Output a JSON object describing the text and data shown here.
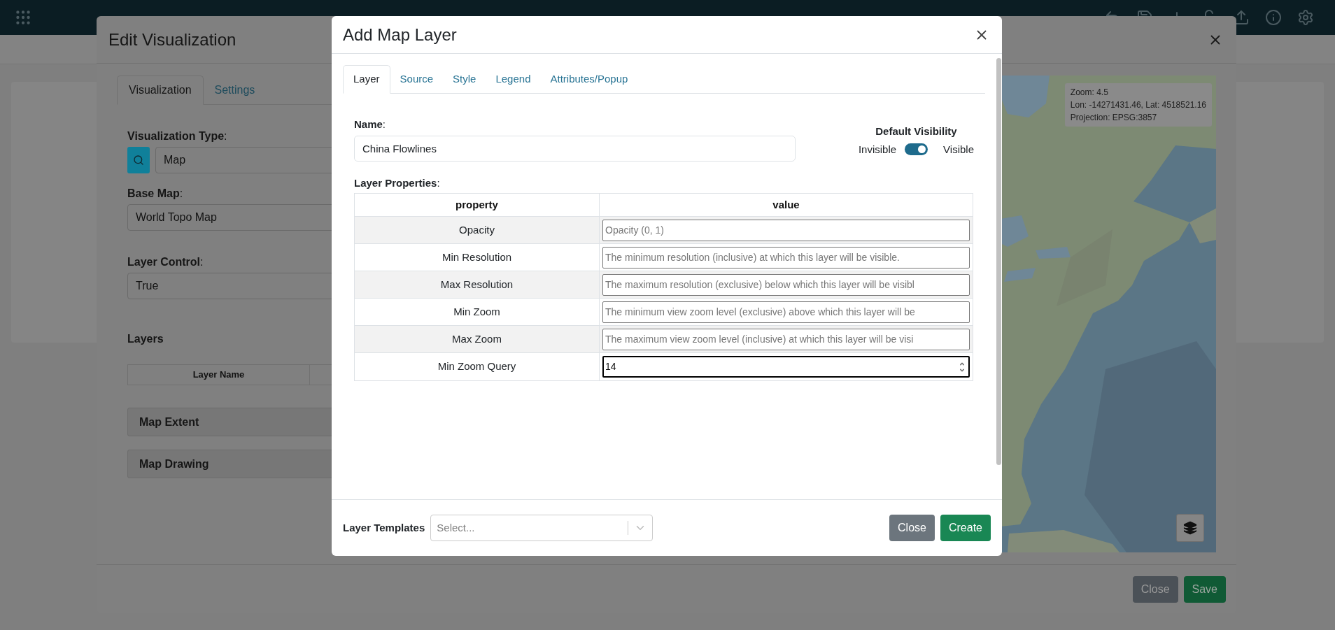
{
  "edit_dialog": {
    "title": "Edit Visualization",
    "tabs": [
      {
        "label": "Visualization",
        "selected": true
      },
      {
        "label": "Settings",
        "selected": false
      }
    ],
    "fields": [
      {
        "label": "**Visualization Type**:",
        "value": "Map",
        "kind": "search-select"
      },
      {
        "label": "**Base Map**:",
        "value": "World Topo Map",
        "kind": "select"
      },
      {
        "label": "**Layer Control**:",
        "value": "True",
        "kind": "select"
      }
    ],
    "layers": {
      "title": "Layers",
      "columns": [
        "Layer Name"
      ]
    },
    "sections": [
      "Map Extent",
      "Map Drawing"
    ],
    "map": {
      "kind": "picture",
      "info": [
        "Zoom: 4.5",
        "Lon: -14271431.46, Lat: 4518521.16",
        "Projection: EPSG:3857"
      ]
    },
    "buttons": [
      {
        "label": "Close",
        "kind": "secondary"
      },
      {
        "label": "Save",
        "kind": "primary"
      }
    ]
  },
  "layer_dialog": {
    "title": "Add Map Layer",
    "tabs": [
      {
        "label": "Layer",
        "selected": true
      },
      {
        "label": "Source",
        "selected": false
      },
      {
        "label": "Style",
        "selected": false
      },
      {
        "label": "Legend",
        "selected": false
      },
      {
        "label": "Attributes/Popup",
        "selected": false
      }
    ],
    "name": {
      "label": "**Name**:",
      "value": "China Flowlines"
    },
    "visibility": {
      "title": "Default Visibility",
      "off_label": "Invisible",
      "on_label": "Visible",
      "on": true
    },
    "properties": {
      "label": "**Layer Properties**:",
      "columns": [
        "property",
        "value"
      ],
      "rows": [
        {
          "property": "Opacity",
          "placeholder": "Opacity (0, 1)",
          "focused": false
        },
        {
          "property": "Min Resolution",
          "placeholder": "The minimum resolution (inclusive) at which this layer will be visible.",
          "focused": false
        },
        {
          "property": "Max Resolution",
          "placeholder": "The maximum resolution (exclusive) below which this layer will be visibl",
          "focused": false
        },
        {
          "property": "Min Zoom",
          "placeholder": "The minimum view zoom level (exclusive) above which this layer will be",
          "focused": false
        },
        {
          "property": "Max Zoom",
          "placeholder": "The maximum view zoom level (inclusive) at which this layer will be visi",
          "focused": false
        },
        {
          "property": "Min Zoom Query",
          "value": "14",
          "focused": true
        }
      ]
    },
    "templates": {
      "label": "Layer Templates",
      "placeholder": "Select..."
    },
    "buttons": [
      {
        "label": "Close",
        "kind": "secondary"
      },
      {
        "label": "Create",
        "kind": "primary"
      }
    ]
  }
}
